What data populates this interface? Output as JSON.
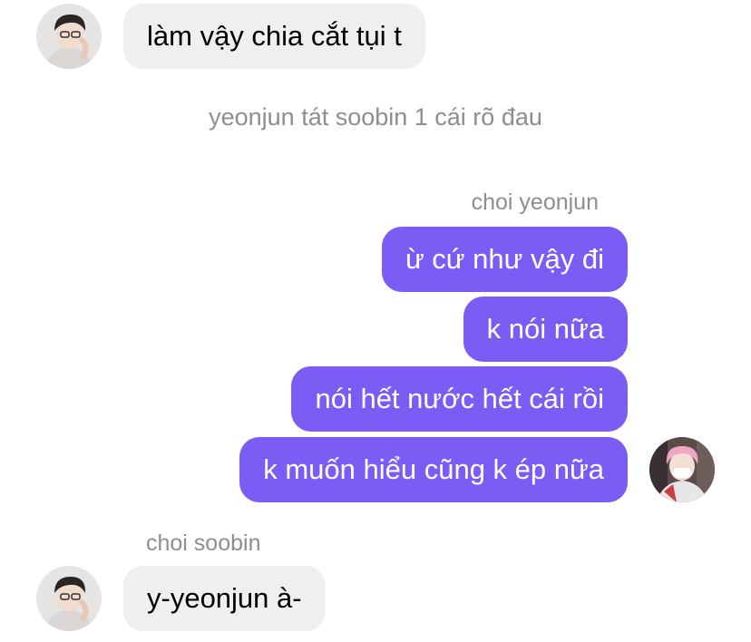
{
  "chat": {
    "messages": [
      {
        "sender": "choi soobin",
        "text": "làm vậy chia cắt tụi t"
      },
      {
        "system_note": "yeonjun tát soobin 1 cái rõ đau"
      },
      {
        "sender_label": "choi yeonjun"
      },
      {
        "sender": "choi yeonjun",
        "text": "ừ cứ như vậy đi"
      },
      {
        "sender": "choi yeonjun",
        "text": "k nói nữa"
      },
      {
        "sender": "choi yeonjun",
        "text": "nói hết nước hết cái rồi"
      },
      {
        "sender": "choi yeonjun",
        "text": "k muốn hiểu cũng k ép nữa"
      },
      {
        "sender_label": "choi soobin"
      },
      {
        "sender": "choi soobin",
        "text": "y-yeonjun à-"
      }
    ]
  },
  "colors": {
    "outgoing_bubble": "#7b5cf5",
    "incoming_bubble": "#efefef",
    "meta_text": "#8e8e8e"
  }
}
